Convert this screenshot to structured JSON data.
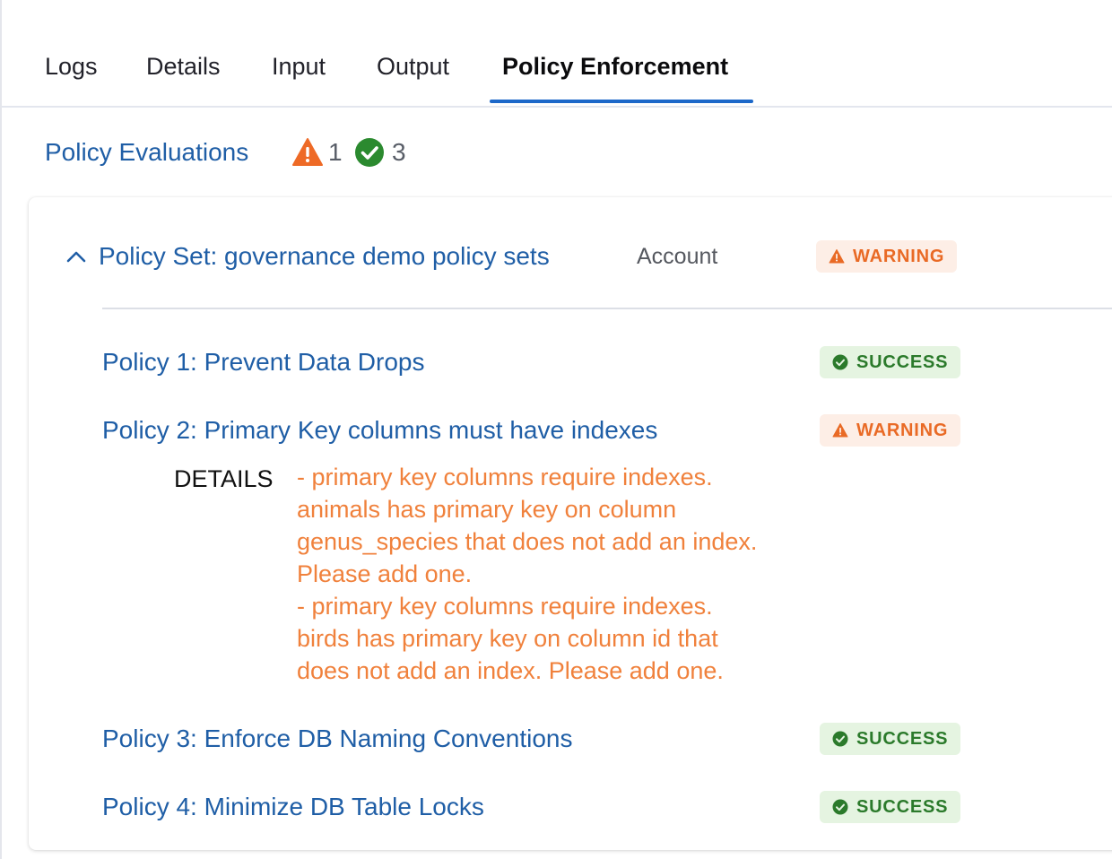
{
  "tabs": [
    {
      "label": "Logs",
      "active": false
    },
    {
      "label": "Details",
      "active": false
    },
    {
      "label": "Input",
      "active": false
    },
    {
      "label": "Output",
      "active": false
    },
    {
      "label": "Policy Enforcement",
      "active": true
    }
  ],
  "summary": {
    "title": "Policy Evaluations",
    "warning_count": "1",
    "success_count": "3",
    "warning_icon": "warning-triangle-icon",
    "success_icon": "check-circle-icon"
  },
  "policy_set": {
    "title": "Policy Set: governance demo policy sets",
    "scope": "Account",
    "status": "WARNING",
    "expanded": true,
    "policies": [
      {
        "name": "Policy 1: Prevent Data Drops",
        "status": "SUCCESS"
      },
      {
        "name": "Policy 2: Primary Key columns must have indexes",
        "status": "WARNING",
        "details_label": "DETAILS",
        "details_lines": [
          "- primary key columns require indexes.",
          "animals has primary key on column",
          "genus_species that does not add an index.",
          "Please add one.",
          "- primary key columns require indexes.",
          "birds has primary key on column id that",
          "does not add an index. Please add one."
        ]
      },
      {
        "name": "Policy 3: Enforce DB Naming Conventions",
        "status": "SUCCESS"
      },
      {
        "name": "Policy 4: Minimize DB Table Locks",
        "status": "SUCCESS"
      }
    ]
  },
  "colors": {
    "link_blue": "#1f5ea6",
    "tab_active_underline": "#1c68c9",
    "warning_orange": "#e96a25",
    "warning_bg": "#fdeee6",
    "success_green": "#2b7a2b",
    "success_bg": "#e5f4e1",
    "details_orange": "#f0813c"
  }
}
